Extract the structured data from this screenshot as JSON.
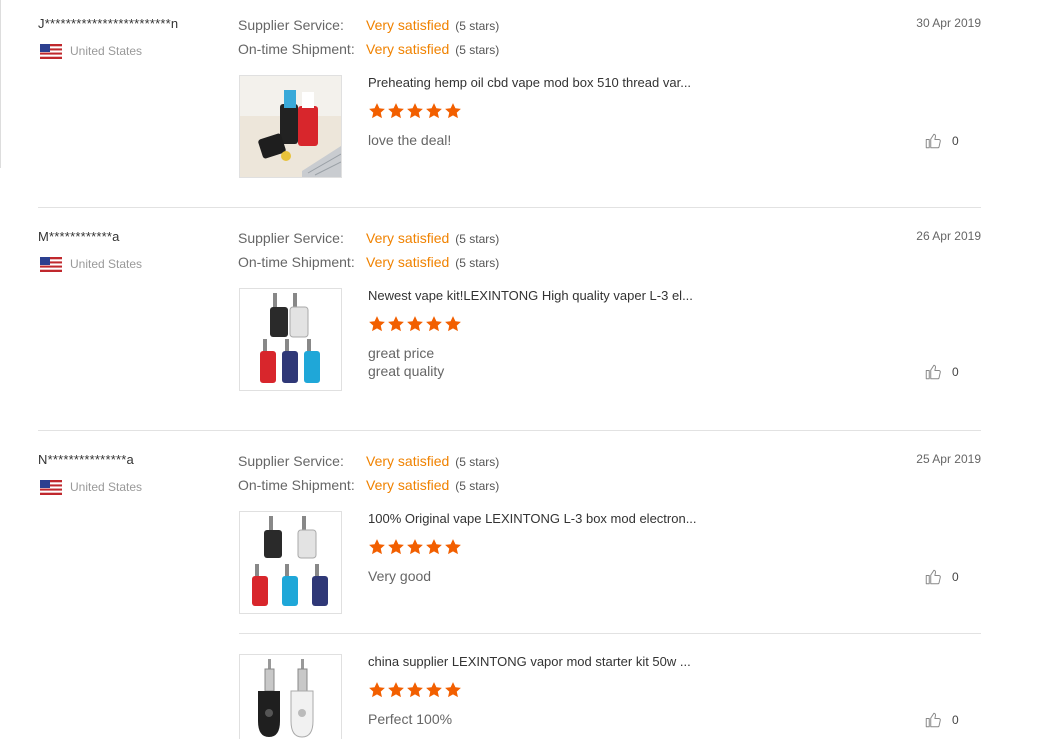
{
  "labels": {
    "supplier_service": "Supplier Service:",
    "on_time_shipment": "On-time Shipment:"
  },
  "colors": {
    "accent": "#f08200",
    "star": "#f25f00"
  },
  "reviews": [
    {
      "buyer": "J************************n",
      "country": "United States",
      "date": "30 Apr 2019",
      "supplier_service": "Very satisfied",
      "supplier_service_stars": "(5 stars)",
      "shipment": "Very satisfied",
      "shipment_stars": "(5 stars)",
      "items": [
        {
          "title": "Preheating hemp oil cbd vape mod box 510 thread var...",
          "rating": 5,
          "comment": [
            "love the deal!"
          ],
          "likes": "0"
        }
      ]
    },
    {
      "buyer": "M************a",
      "country": "United States",
      "date": "26 Apr 2019",
      "supplier_service": "Very satisfied",
      "supplier_service_stars": "(5 stars)",
      "shipment": "Very satisfied",
      "shipment_stars": "(5 stars)",
      "items": [
        {
          "title": "Newest vape kit!LEXINTONG High quality vaper L-3 el...",
          "rating": 5,
          "comment": [
            "great price",
            "great quality"
          ],
          "likes": "0"
        }
      ]
    },
    {
      "buyer": "N***************a",
      "country": "United States",
      "date": "25 Apr 2019",
      "supplier_service": "Very satisfied",
      "supplier_service_stars": "(5 stars)",
      "shipment": "Very satisfied",
      "shipment_stars": "(5 stars)",
      "items": [
        {
          "title": "100% Original vape LEXINTONG L-3 box mod electron...",
          "rating": 5,
          "comment": [
            "Very good"
          ],
          "likes": "0"
        },
        {
          "title": "china supplier LEXINTONG vapor mod starter kit 50w ...",
          "rating": 5,
          "comment": [
            "Perfect 100%"
          ],
          "likes": "0"
        }
      ]
    }
  ]
}
